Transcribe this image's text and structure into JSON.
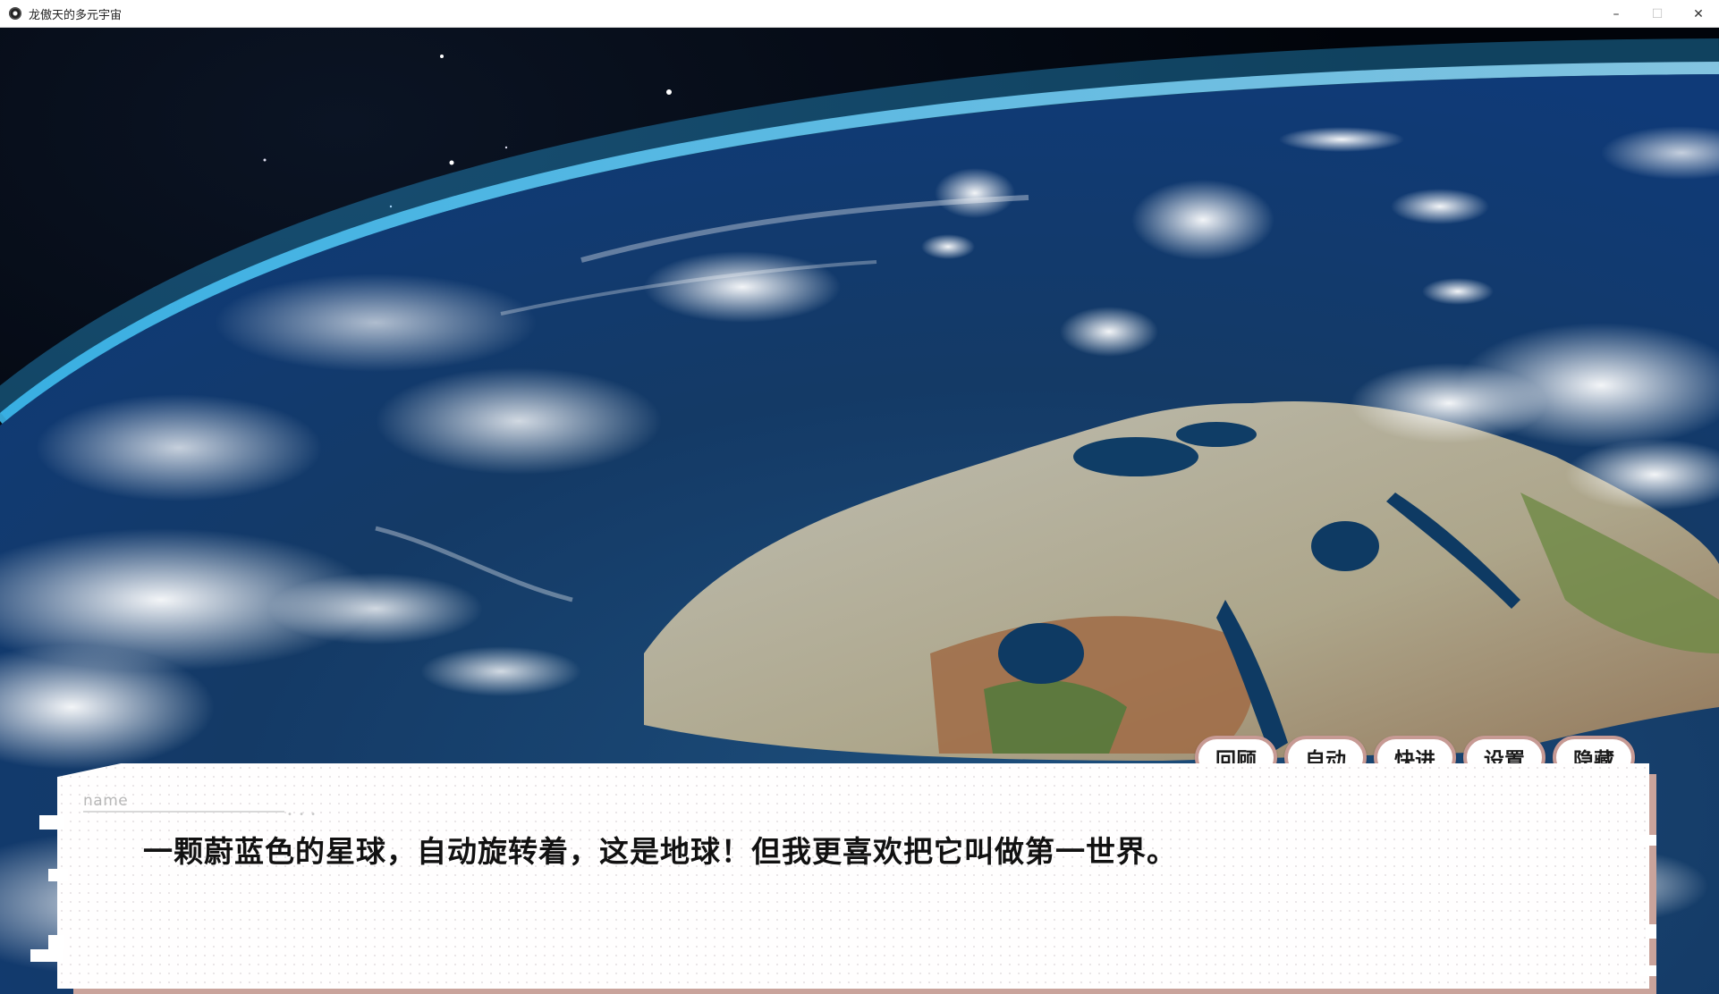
{
  "window": {
    "title": "龙傲天的多元宇宙",
    "controls": {
      "minimize": "–",
      "maximize": "☐",
      "close": "✕"
    }
  },
  "dialog": {
    "speaker_name": "name",
    "name_dots": "• • •",
    "text": "一颗蔚蓝色的星球，自动旋转着，这是地球！但我更喜欢把它叫做第一世界。"
  },
  "quick_menu": {
    "history": "回顾",
    "auto": "自动",
    "skip": "快进",
    "settings": "设置",
    "hide": "隐藏"
  },
  "colors": {
    "accent": "#c79a94",
    "dialog_shadow": "#c9a39b",
    "dialog_bg": "#fffefe"
  },
  "icons": {
    "app": "app-icon",
    "minimize": "minimize-icon",
    "maximize": "maximize-icon",
    "close": "close-icon"
  }
}
